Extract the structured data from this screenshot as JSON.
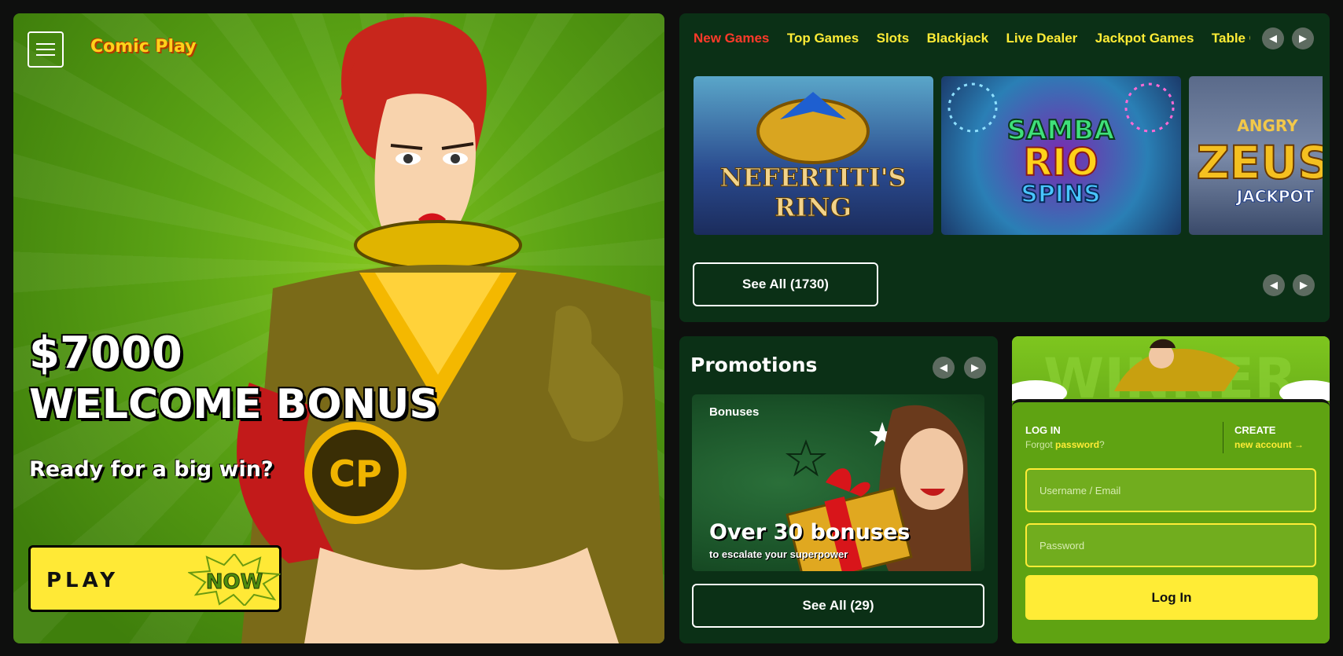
{
  "hero": {
    "menu_icon": "hamburger-menu-icon",
    "logo_text": "Comic Play",
    "bonus_amount": "$7000",
    "bonus_title": "WELCOME BONUS",
    "bonus_subtitle": "Ready for a big win?",
    "play_label": "PLAY",
    "now_badge": "NOW"
  },
  "games": {
    "tabs": [
      {
        "label": "New Games",
        "active": true
      },
      {
        "label": "Top Games",
        "active": false
      },
      {
        "label": "Slots",
        "active": false
      },
      {
        "label": "Blackjack",
        "active": false
      },
      {
        "label": "Live Dealer",
        "active": false
      },
      {
        "label": "Jackpot Games",
        "active": false
      },
      {
        "label": "Table Games",
        "active": false
      }
    ],
    "thumbnails": [
      {
        "title_line1": "NEFERTITI'S",
        "title_line2": "RING"
      },
      {
        "title_line1": "SAMBA",
        "title_line2": "RIO",
        "title_line3": "SPINS"
      },
      {
        "title_line1": "ANGRY",
        "title_line2": "ZEUS",
        "title_line3": "JACKPOT"
      }
    ],
    "see_all_label": "See All (1730)"
  },
  "promotions": {
    "title": "Promotions",
    "card": {
      "tag": "Bonuses",
      "headline": "Over 30 bonuses",
      "subline": "to escalate your superpower"
    },
    "see_all_label": "See All (29)"
  },
  "login": {
    "login_label": "LOG IN",
    "forgot_prefix": "Forgot ",
    "forgot_link": "password",
    "forgot_suffix": "?",
    "create_label": "CREATE",
    "new_account_link": "new account →",
    "username_placeholder": "Username / Email",
    "password_placeholder": "Password",
    "submit_label": "Log In"
  },
  "colors": {
    "accent_yellow": "#ffec36",
    "active_tab_red": "#ff3a2a",
    "panel_green": "#0b3016",
    "hero_green": "#5aa214"
  }
}
